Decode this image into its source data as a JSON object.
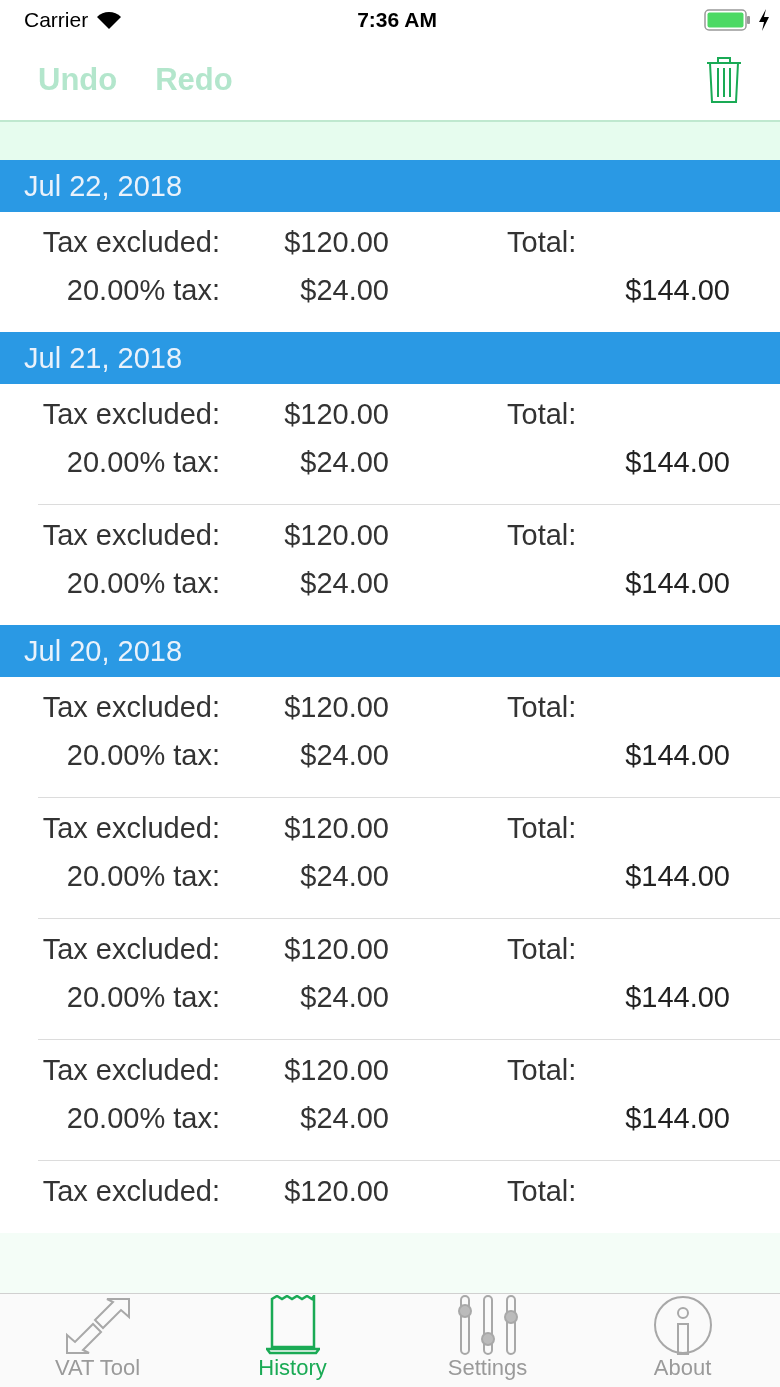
{
  "status_bar": {
    "carrier": "Carrier",
    "time": "7:36 AM"
  },
  "nav": {
    "buttons": [
      {
        "label": "Undo",
        "disabled": true
      },
      {
        "label": "Redo",
        "disabled": true
      }
    ]
  },
  "sections": [
    {
      "date": "Jul 22, 2018",
      "entries": [
        {
          "excluded_label": "Tax excluded:",
          "excluded": "$120.00",
          "tax_label": "20.00% tax:",
          "tax": "$24.00",
          "total_label": "Total:",
          "total": "$144.00"
        }
      ]
    },
    {
      "date": "Jul 21, 2018",
      "entries": [
        {
          "excluded_label": "Tax excluded:",
          "excluded": "$120.00",
          "tax_label": "20.00% tax:",
          "tax": "$24.00",
          "total_label": "Total:",
          "total": "$144.00"
        },
        {
          "excluded_label": "Tax excluded:",
          "excluded": "$120.00",
          "tax_label": "20.00% tax:",
          "tax": "$24.00",
          "total_label": "Total:",
          "total": "$144.00"
        }
      ]
    },
    {
      "date": "Jul 20, 2018",
      "entries": [
        {
          "excluded_label": "Tax excluded:",
          "excluded": "$120.00",
          "tax_label": "20.00% tax:",
          "tax": "$24.00",
          "total_label": "Total:",
          "total": "$144.00"
        },
        {
          "excluded_label": "Tax excluded:",
          "excluded": "$120.00",
          "tax_label": "20.00% tax:",
          "tax": "$24.00",
          "total_label": "Total:",
          "total": "$144.00"
        },
        {
          "excluded_label": "Tax excluded:",
          "excluded": "$120.00",
          "tax_label": "20.00% tax:",
          "tax": "$24.00",
          "total_label": "Total:",
          "total": "$144.00"
        },
        {
          "excluded_label": "Tax excluded:",
          "excluded": "$120.00",
          "tax_label": "20.00% tax:",
          "tax": "$24.00",
          "total_label": "Total:",
          "total": "$144.00"
        },
        {
          "excluded_label": "Tax excluded:",
          "excluded": "$120.00",
          "total_label": "Total:"
        }
      ]
    }
  ],
  "tabs": [
    {
      "label": "VAT Tool",
      "kind": "arrows",
      "selected": false
    },
    {
      "label": "History",
      "kind": "receipt",
      "selected": true
    },
    {
      "label": "Settings",
      "kind": "sliders",
      "selected": false
    },
    {
      "label": "About",
      "kind": "info",
      "selected": false
    }
  ]
}
